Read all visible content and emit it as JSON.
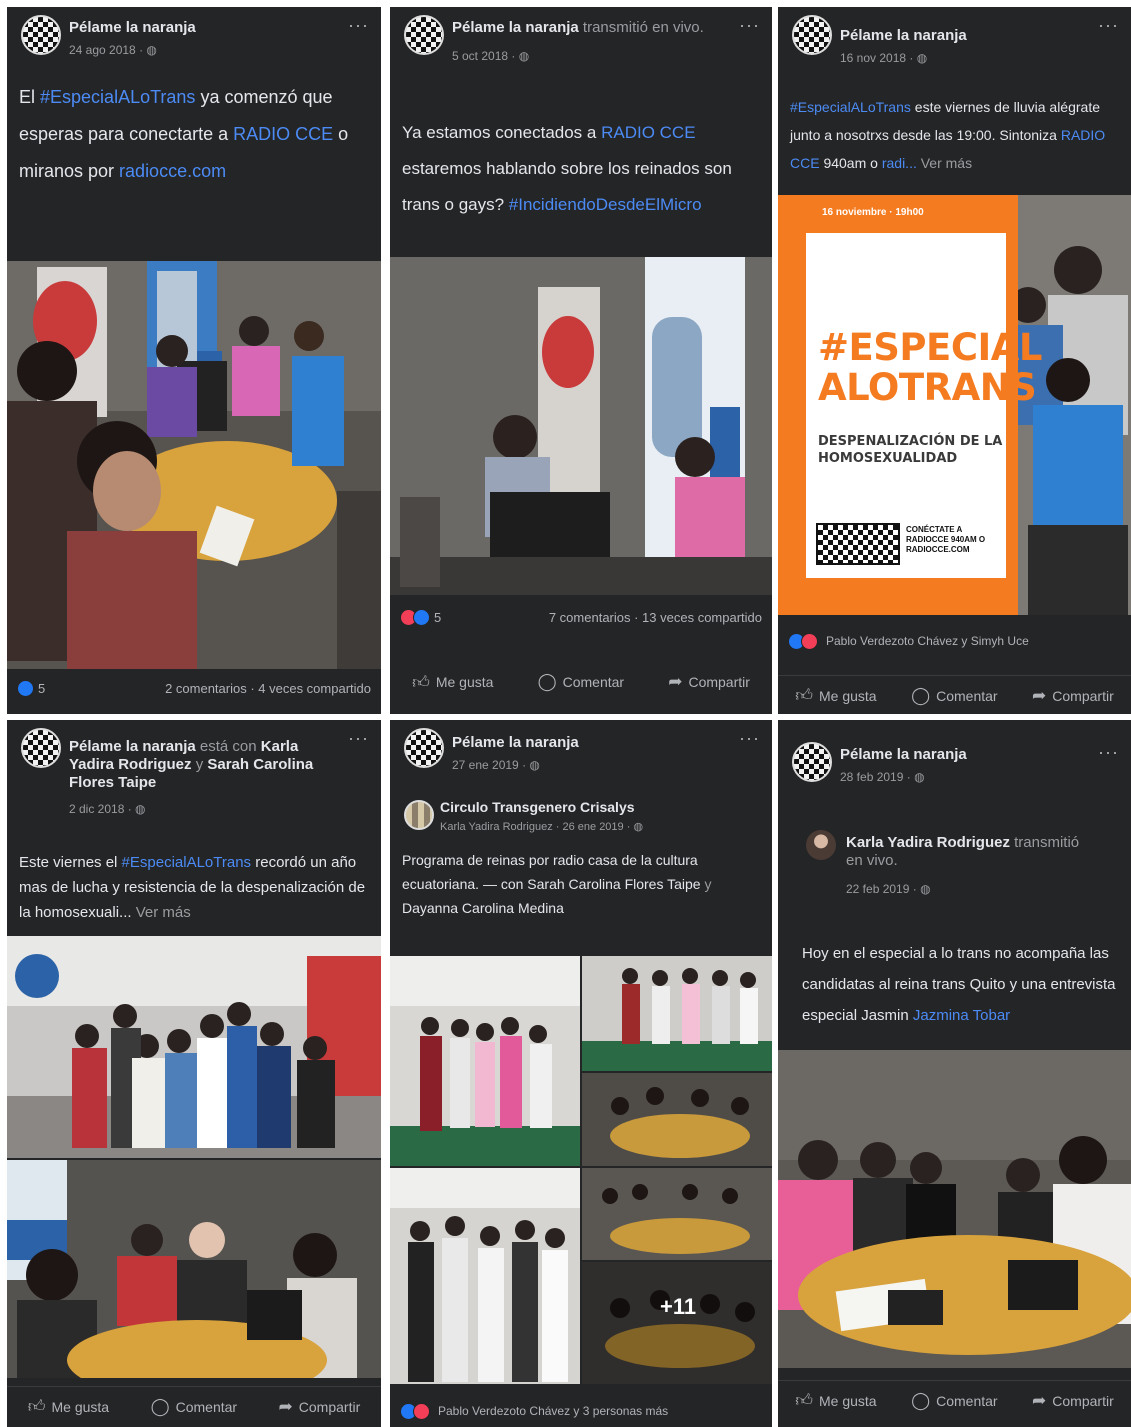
{
  "posts": [
    {
      "page": "Pélame la naranja",
      "date": "24 ago 2018 · ",
      "text_a": "El ",
      "tag": "#EspecialALoTrans",
      "text_b": " ya comenzó que esperas para conectarte a ",
      "link1": "RADIO CCE",
      "text_c": " o miranos por ",
      "link2": "radiocce.com",
      "reactions": "5",
      "stats": "2 comentarios · 4 veces compartido"
    },
    {
      "page": "Pélame la naranja",
      "action": " transmitió en vivo.",
      "date": "5 oct 2018 · ",
      "text_a": "Ya estamos conectados a ",
      "link1": "RADIO CCE",
      "text_b": " estaremos hablando sobre los reinados son trans o gays? ",
      "tag": "#IncidiendoDesdeElMicro",
      "reactions": "5",
      "stats": "7 comentarios · 13 veces compartido"
    },
    {
      "page": "Pélame la naranja",
      "date": "16 nov 2018 · ",
      "tag": "#EspecialALoTrans",
      "text_a": " este viernes de lluvia alégrate junto a nosotrxs desde las 19:00. Sintoniza ",
      "link1": "RADIO CCE",
      "text_b": " 940am o ",
      "link2": "radi...",
      "more": " Ver más",
      "poster_date": "16 noviembre · 19h00",
      "poster_title": "#ESPECIAL ALOTRANS",
      "poster_sub": "DESPENALIZACIÓN DE LA HOMOSEXUALIDAD",
      "poster_cta": "CONÉCTATE A RADIOCCE 940AM O RADIOCCE.COM",
      "reacted_by": "Pablo Verdezoto Chávez y Simyh Uce"
    },
    {
      "page": "Pélame la naranja",
      "with": " está con ",
      "person1": "Karla Yadira Rodriguez",
      "and": " y ",
      "person2": "Sarah Carolina Flores Taipe",
      "date": "2 dic 2018 · ",
      "text_a": "Este viernes el ",
      "tag": "#EspecialALoTrans",
      "text_b": " recordó un año mas de lucha y resistencia de la despenalización de la homosexuali...",
      "more": " Ver más"
    },
    {
      "page": "Pélame la naranja",
      "date": "27 ene 2019 · ",
      "shared_page": "Circulo Transgenero Crisalys",
      "shared_by": "Karla Yadira Rodriguez · 26 ene 2019 · ",
      "text_a": "Programa de reinas por radio casa de la cultura ecuatoriana. — con ",
      "person1": "Sarah Carolina Flores Taipe",
      "and": " y ",
      "person2": "Dayanna Carolina Medina",
      "photo_badge": "+11",
      "reacted_by": "Pablo Verdezoto Chávez y 3 personas más"
    },
    {
      "page": "Pélame la naranja",
      "date": "28 feb 2019 · ",
      "shared_person": "Karla Yadira Rodriguez",
      "shared_action": " transmitió en vivo.",
      "shared_date": "22 feb 2019 · ",
      "text_a": "Hoy en el especial a lo trans no acompaña las candidatas al reina trans Quito y una entrevista especial Jasmin ",
      "link1": "Jazmina Tobar"
    }
  ],
  "actions": {
    "like": "Me gusta",
    "comment": "Comentar",
    "share": "Compartir"
  },
  "icons": {
    "menu": "more-dots-icon",
    "globe": "globe-icon",
    "like": "thumbs-up-icon",
    "comment": "comment-bubble-icon",
    "share": "share-arrow-icon",
    "love": "heart-icon"
  },
  "colors": {
    "card": "#242526",
    "link": "#4c8bf5",
    "like": "#2078f4",
    "love": "#f33e58",
    "poster": "#f47b20"
  }
}
